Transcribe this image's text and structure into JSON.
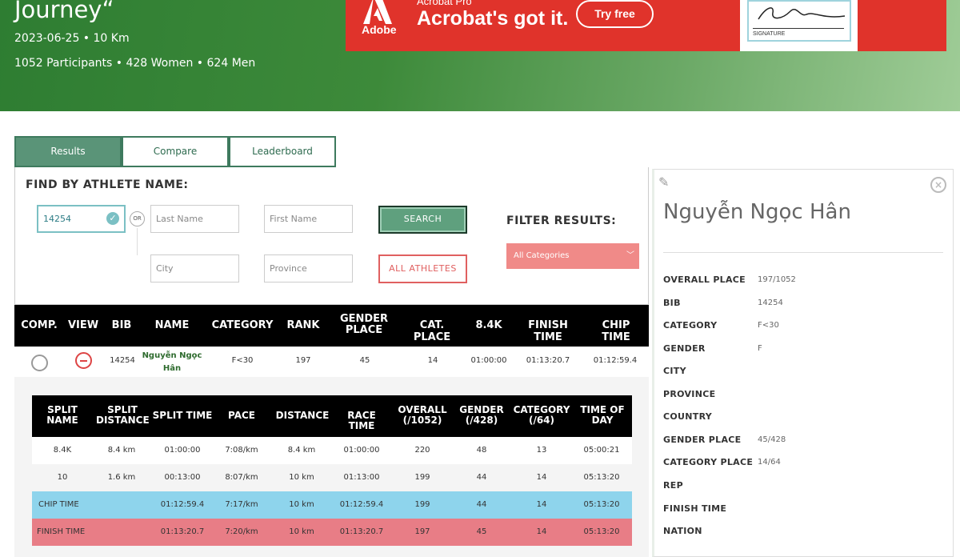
{
  "header": {
    "title": "Journey“",
    "date_line": "2023-06-25 • 10 Km",
    "participants": "1052 Participants • 428 Women • 624 Men"
  },
  "ad": {
    "brand": "Adobe",
    "product": "Acrobat Pro",
    "tagline": "Acrobat's got it.",
    "cta": "Try free",
    "signature_label": "SIGNATURE"
  },
  "tabs": [
    {
      "label": "Results",
      "active": true
    },
    {
      "label": "Compare",
      "active": false
    },
    {
      "label": "Leaderboard",
      "active": false
    }
  ],
  "search": {
    "heading": "FIND BY ATHLETE NAME:",
    "bib_value": "14254",
    "or_label": "OR",
    "last_name_placeholder": "Last Name",
    "first_name_placeholder": "First Name",
    "city_placeholder": "City",
    "province_placeholder": "Province",
    "search_button": "SEARCH",
    "all_athletes_button": "ALL ATHLETES",
    "filter_heading": "FILTER RESULTS:",
    "filter_value": "All Categories"
  },
  "results": {
    "headers": {
      "comp": "COMP.",
      "view": "VIEW",
      "bib": "BIB",
      "name": "NAME",
      "category": "CATEGORY",
      "rank": "RANK",
      "gender_place_1": "GENDER",
      "gender_place_2": "PLACE",
      "cat_place": "CAT. PLACE",
      "split": "8.4K",
      "finish": "FINISH TIME",
      "chip": "CHIP TIME"
    },
    "row": {
      "bib": "14254",
      "name_1": "Nguyễn Ngọc",
      "name_2": "Hân",
      "category": "F<30",
      "rank": "197",
      "gender_place": "45",
      "cat_place": "14",
      "split": "01:00:00",
      "finish": "01:13:20.7",
      "chip": "01:12:59.4"
    }
  },
  "splits": {
    "headers": {
      "name_1": "SPLIT",
      "name_2": "NAME",
      "dist_1": "SPLIT",
      "dist_2": "DISTANCE",
      "time": "SPLIT TIME",
      "pace": "PACE",
      "distance": "DISTANCE",
      "race": "RACE TIME",
      "overall_1": "OVERALL",
      "overall_2": "(/1052)",
      "gender_1": "GENDER",
      "gender_2": "(/428)",
      "category_1": "CATEGORY",
      "category_2": "(/64)",
      "tod_1": "TIME OF",
      "tod_2": "DAY"
    },
    "rows": [
      {
        "name": "8.4K",
        "split_distance": "8.4 km",
        "split_time": "01:00:00",
        "pace": "7:08/km",
        "distance": "8.4 km",
        "race_time": "01:00:00",
        "overall": "220",
        "gender": "48",
        "category": "13",
        "time_of_day": "05:00:21"
      },
      {
        "name": "10",
        "split_distance": "1.6 km",
        "split_time": "00:13:00",
        "pace": "8:07/km",
        "distance": "10 km",
        "race_time": "01:13:00",
        "overall": "199",
        "gender": "44",
        "category": "14",
        "time_of_day": "05:13:20"
      },
      {
        "name": "CHIP TIME",
        "split_distance": "",
        "split_time": "01:12:59.4",
        "pace": "7:17/km",
        "distance": "10 km",
        "race_time": "01:12:59.4",
        "overall": "199",
        "gender": "44",
        "category": "14",
        "time_of_day": "05:13:20"
      },
      {
        "name": "FINISH TIME",
        "split_distance": "",
        "split_time": "01:13:20.7",
        "pace": "7:20/km",
        "distance": "10 km",
        "race_time": "01:13:20.7",
        "overall": "197",
        "gender": "45",
        "category": "14",
        "time_of_day": "05:13:20"
      }
    ]
  },
  "athlete_panel": {
    "name": "Nguyễn Ngọc Hân",
    "fields": [
      {
        "label": "OVERALL PLACE",
        "value": "197/1052"
      },
      {
        "label": "BIB",
        "value": "14254"
      },
      {
        "label": "CATEGORY",
        "value": "F<30"
      },
      {
        "label": "GENDER",
        "value": "F"
      },
      {
        "label": "CITY",
        "value": ""
      },
      {
        "label": "PROVINCE",
        "value": ""
      },
      {
        "label": "COUNTRY",
        "value": ""
      },
      {
        "label": "GENDER PLACE",
        "value": "45/428"
      },
      {
        "label": "CATEGORY PLACE",
        "value": "14/64"
      },
      {
        "label": "REP",
        "value": ""
      },
      {
        "label": "FINISH TIME",
        "value": ""
      },
      {
        "label": "NATION",
        "value": ""
      }
    ]
  },
  "colors": {
    "header_green": "#2e7d32",
    "tab_active": "#5a9478",
    "chip_row": "#8ed4ec",
    "finish_row": "#e87d86",
    "ad_red": "#e0332b"
  }
}
